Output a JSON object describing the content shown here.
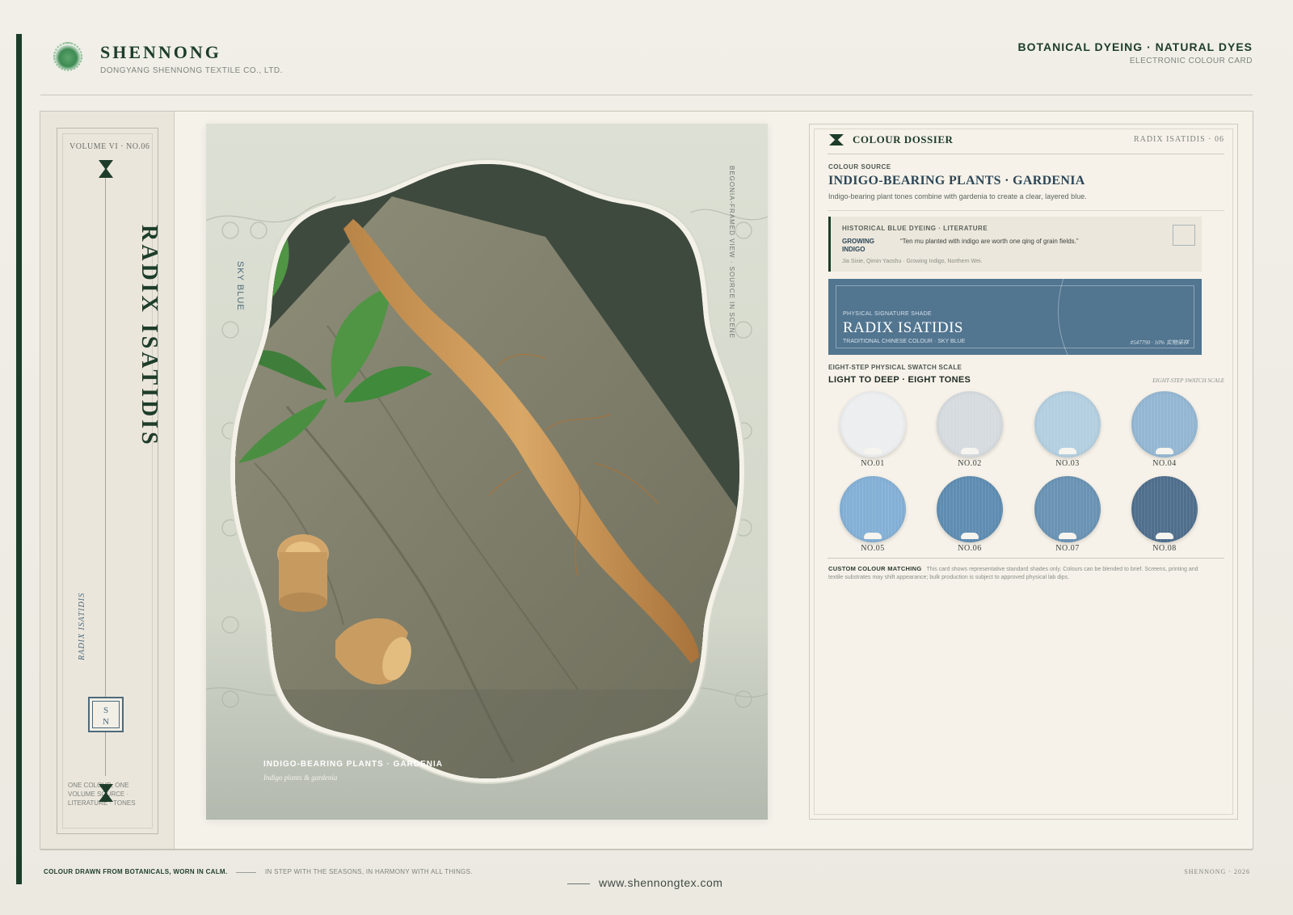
{
  "header": {
    "brand": "SHENNONG",
    "brand_sub": "DONGYANG SHENNONG TEXTILE CO., LTD.",
    "right_title": "BOTANICAL DYEING · NATURAL DYES",
    "right_sub": "ELECTRONIC COLOUR CARD"
  },
  "spine": {
    "volume": "VOLUME VI · NO.06",
    "title": "RADIX ISATIDIS",
    "italic": "RADIX ISATIDIS",
    "seal_top": "S",
    "seal_bottom": "N",
    "footer": "ONE COLOUR, ONE VOLUME SOURCE · LITERATURE · TONES"
  },
  "hero": {
    "vertical_label": "SKY BLUE",
    "vertical_label_right": "BEGONIA-FRAMED VIEW · SOURCE IN SCENE",
    "caption": "INDIGO-BEARING PLANTS · GARDENIA",
    "caption_sub": "Indigo plants & gardenia"
  },
  "dossier": {
    "title": "COLOUR DOSSIER",
    "ref": "RADIX ISATIDIS · 06",
    "source_label": "COLOUR SOURCE",
    "source": "INDIGO-BEARING PLANTS · GARDENIA",
    "description": "Indigo-bearing plant tones combine with gardenia to create a clear, layered blue.",
    "literature": {
      "label": "HISTORICAL BLUE DYEING · LITERATURE",
      "tag": "GROWING INDIGO",
      "quote": "“Ten mu planted with indigo are worth one qing of grain fields.”",
      "citation": "Jia Sixie, Qimin Yaoshu · Growing Indigo, Northern Wei."
    },
    "shade": {
      "label": "PHYSICAL SIGNATURE SHADE",
      "name": "RADIX ISATIDIS",
      "sub": "TRADITIONAL CHINESE COLOUR · SKY BLUE",
      "code": "#547790 · 10% 实物采样",
      "color": "#527590"
    },
    "scale_label": "EIGHT-STEP PHYSICAL SWATCH SCALE",
    "scale_title": "LIGHT TO DEEP · EIGHT TONES",
    "scale_italic": "EIGHT-STEP SWATCH SCALE",
    "swatches": [
      {
        "no": "NO.01",
        "color": "#eceeef"
      },
      {
        "no": "NO.02",
        "color": "#d6dbdf"
      },
      {
        "no": "NO.03",
        "color": "#b3cfe0"
      },
      {
        "no": "NO.04",
        "color": "#94b7d3"
      },
      {
        "no": "NO.05",
        "color": "#84b0d6"
      },
      {
        "no": "NO.06",
        "color": "#5f8db2"
      },
      {
        "no": "NO.07",
        "color": "#6a93b4"
      },
      {
        "no": "NO.08",
        "color": "#4f6f8d"
      }
    ],
    "custom_label": "CUSTOM COLOUR MATCHING",
    "custom_text": "This card shows representative standard shades only. Colours can be blended to brief. Screens, printing and textile substrates may shift appearance; bulk production is subject to approved physical lab dips."
  },
  "footer": {
    "left": "COLOUR DRAWN FROM BOTANICALS, WORN IN CALM.",
    "middle": "IN STEP WITH THE SEASONS, IN HARMONY WITH ALL THINGS.",
    "url": "www.shennongtex.com",
    "right": "SHENNONG · 2026"
  }
}
